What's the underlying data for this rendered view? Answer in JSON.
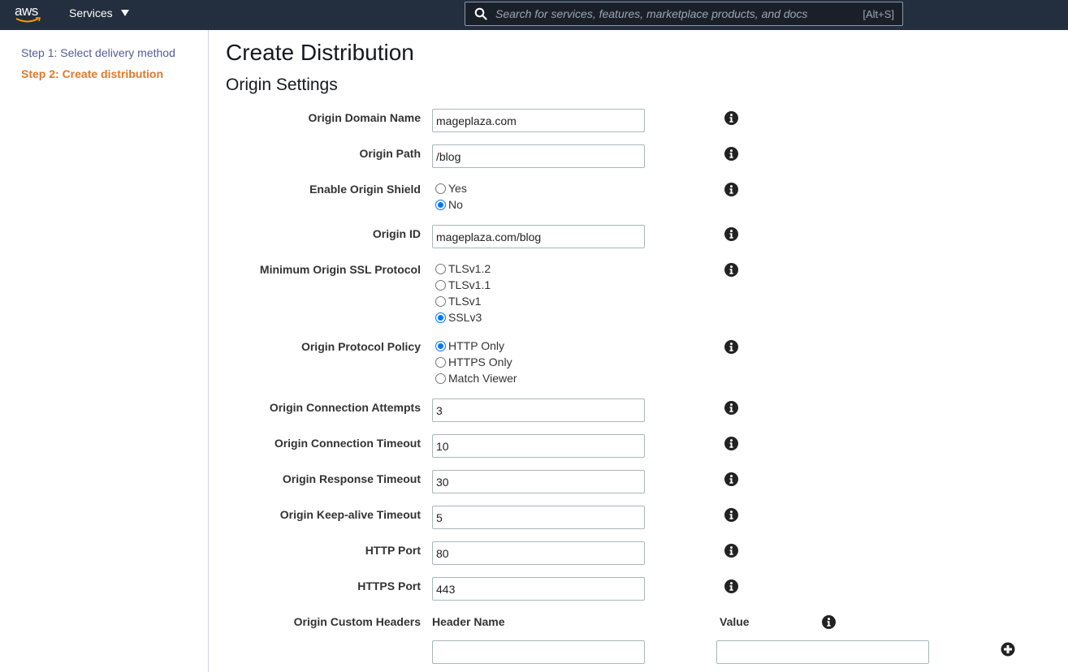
{
  "topnav": {
    "logo_text": "aws",
    "services_label": "Services",
    "search_placeholder": "Search for services, features, marketplace products, and docs",
    "search_shortcut": "[Alt+S]"
  },
  "sidebar": {
    "steps": [
      {
        "label": "Step 1: Select delivery method",
        "active": false
      },
      {
        "label": "Step 2: Create distribution",
        "active": true
      }
    ]
  },
  "main": {
    "title": "Create Distribution",
    "section_title": "Origin Settings",
    "fields": {
      "origin_domain_name": {
        "label": "Origin Domain Name",
        "value": "mageplaza.com"
      },
      "origin_path": {
        "label": "Origin Path",
        "value": "/blog"
      },
      "enable_origin_shield": {
        "label": "Enable Origin Shield",
        "options": [
          "Yes",
          "No"
        ],
        "selected": "No"
      },
      "origin_id": {
        "label": "Origin ID",
        "value": "mageplaza.com/blog"
      },
      "min_ssl_protocol": {
        "label": "Minimum Origin SSL Protocol",
        "options": [
          "TLSv1.2",
          "TLSv1.1",
          "TLSv1",
          "SSLv3"
        ],
        "selected": "SSLv3"
      },
      "origin_protocol_policy": {
        "label": "Origin Protocol Policy",
        "options": [
          "HTTP Only",
          "HTTPS Only",
          "Match Viewer"
        ],
        "selected": "HTTP Only"
      },
      "connection_attempts": {
        "label": "Origin Connection Attempts",
        "value": "3"
      },
      "connection_timeout": {
        "label": "Origin Connection Timeout",
        "value": "10"
      },
      "response_timeout": {
        "label": "Origin Response Timeout",
        "value": "30"
      },
      "keepalive_timeout": {
        "label": "Origin Keep-alive Timeout",
        "value": "5"
      },
      "http_port": {
        "label": "HTTP Port",
        "value": "80"
      },
      "https_port": {
        "label": "HTTPS Port",
        "value": "443"
      },
      "custom_headers": {
        "label": "Origin Custom Headers",
        "header_name_col": "Header Name",
        "value_col": "Value",
        "header_name_value": "",
        "value_value": ""
      }
    }
  },
  "colors": {
    "nav_bg": "#232f3e",
    "step_inactive": "#545b98",
    "step_active": "#dd7a2c",
    "radio_checked": "#0075ff"
  }
}
